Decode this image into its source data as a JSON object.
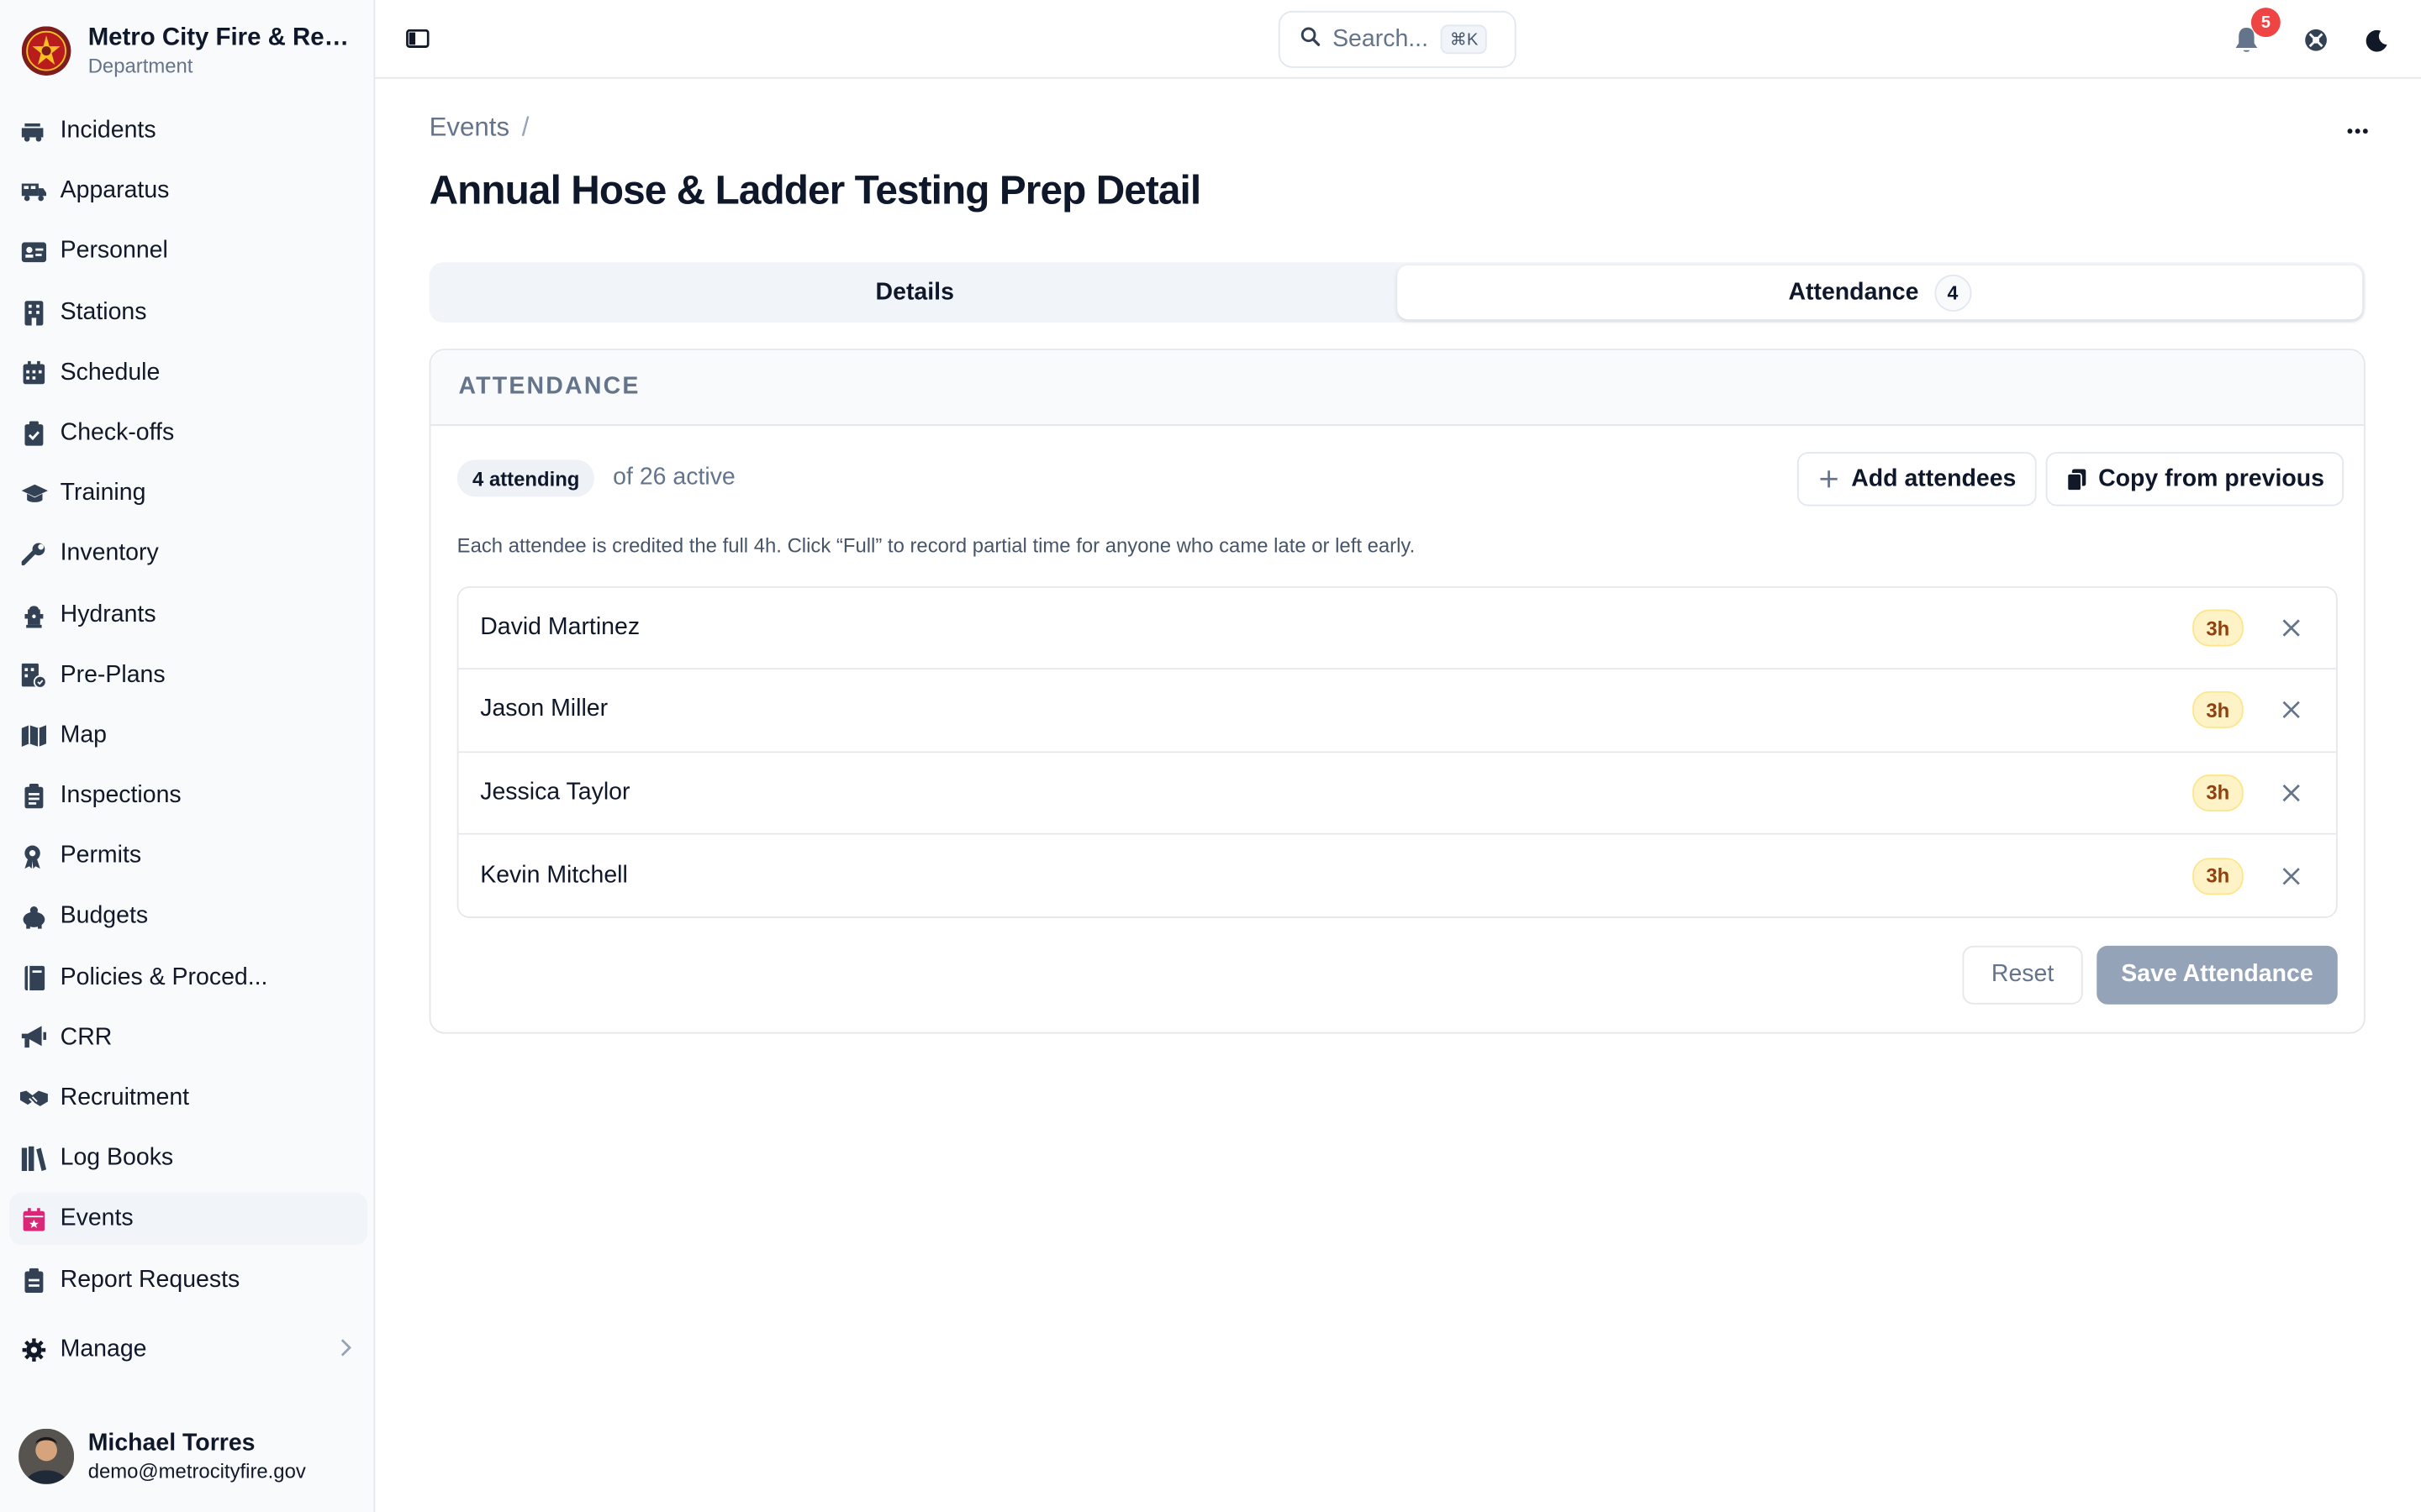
{
  "brand": {
    "name": "Metro City Fire & Resc...",
    "subtitle": "Department"
  },
  "sidebar": {
    "items": [
      {
        "label": "Incidents",
        "icon": "fire-truck-icon"
      },
      {
        "label": "Apparatus",
        "icon": "truck-icon"
      },
      {
        "label": "Personnel",
        "icon": "id-card-icon"
      },
      {
        "label": "Stations",
        "icon": "building-icon"
      },
      {
        "label": "Schedule",
        "icon": "calendar-icon"
      },
      {
        "label": "Check-offs",
        "icon": "clipboard-check-icon"
      },
      {
        "label": "Training",
        "icon": "graduation-cap-icon"
      },
      {
        "label": "Inventory",
        "icon": "wrench-icon"
      },
      {
        "label": "Hydrants",
        "icon": "hydrant-icon"
      },
      {
        "label": "Pre-Plans",
        "icon": "map-plan-icon"
      },
      {
        "label": "Map",
        "icon": "map-icon"
      },
      {
        "label": "Inspections",
        "icon": "clipboard-icon"
      },
      {
        "label": "Permits",
        "icon": "permit-icon"
      },
      {
        "label": "Budgets",
        "icon": "piggy-bank-icon"
      },
      {
        "label": "Policies & Proced...",
        "icon": "book-icon"
      },
      {
        "label": "CRR",
        "icon": "megaphone-icon"
      },
      {
        "label": "Recruitment",
        "icon": "handshake-icon"
      },
      {
        "label": "Log Books",
        "icon": "books-icon"
      },
      {
        "label": "Events",
        "icon": "calendar-star-icon"
      },
      {
        "label": "Report Requests",
        "icon": "report-icon"
      }
    ],
    "manage_label": "Manage"
  },
  "user": {
    "name": "Michael Torres",
    "email": "demo@metrocityfire.gov"
  },
  "topbar": {
    "search_placeholder": "Search...",
    "search_shortcut": "⌘K",
    "notification_count": "5"
  },
  "page": {
    "breadcrumb": "Events",
    "breadcrumb_sep": "/",
    "title": "Annual Hose & Ladder Testing Prep Detail",
    "tabs": [
      {
        "label": "Details"
      },
      {
        "label": "Attendance",
        "count": "4"
      }
    ]
  },
  "attendance": {
    "header": "ATTENDANCE",
    "attending_pill": "4 attending",
    "of_active": "of 26 active",
    "add_button": "Add attendees",
    "copy_button": "Copy from previous",
    "hint": "Each attendee is credited the full 4h. Click “Full” to record partial time for anyone who came late or left early.",
    "attendees": [
      {
        "name": "David Martinez",
        "hours": "3h"
      },
      {
        "name": "Jason Miller",
        "hours": "3h"
      },
      {
        "name": "Jessica Taylor",
        "hours": "3h"
      },
      {
        "name": "Kevin Mitchell",
        "hours": "3h"
      }
    ],
    "reset_button": "Reset",
    "save_button": "Save Attendance"
  },
  "colors": {
    "accent_active_icon": "#db2777",
    "save_disabled": "#94a3b8",
    "hours_badge_bg": "#fef3c7",
    "notification_badge": "#ef4444"
  }
}
